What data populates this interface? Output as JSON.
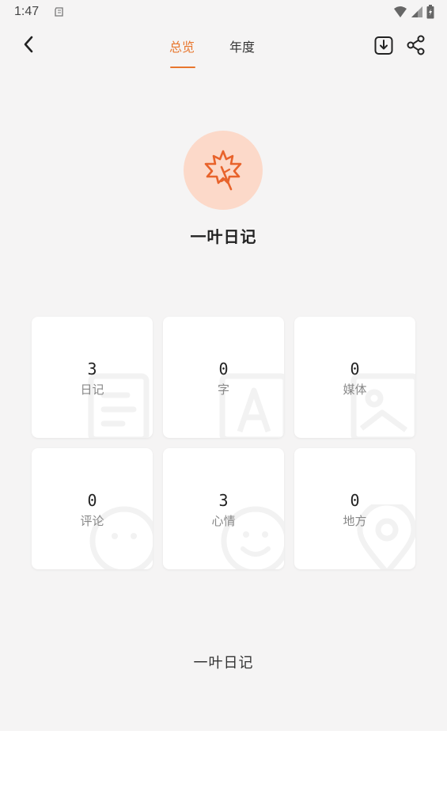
{
  "status_bar": {
    "time": "1:47"
  },
  "header": {
    "tabs": [
      {
        "label": "总览",
        "active": true
      },
      {
        "label": "年度",
        "active": false
      }
    ]
  },
  "app": {
    "name": "一叶日记",
    "footer_name": "一叶日记"
  },
  "stats": [
    {
      "value": "3",
      "label": "日记",
      "icon": "document-icon"
    },
    {
      "value": "0",
      "label": "字",
      "icon": "letter-icon"
    },
    {
      "value": "0",
      "label": "媒体",
      "icon": "image-icon"
    },
    {
      "value": "0",
      "label": "评论",
      "icon": "comment-face-icon"
    },
    {
      "value": "3",
      "label": "心情",
      "icon": "smile-icon"
    },
    {
      "value": "0",
      "label": "地方",
      "icon": "location-pin-icon"
    }
  ],
  "colors": {
    "accent": "#e8762d",
    "logo_bg": "#fcd9c9",
    "page_bg": "#f5f4f4",
    "card_bg": "#ffffff"
  }
}
